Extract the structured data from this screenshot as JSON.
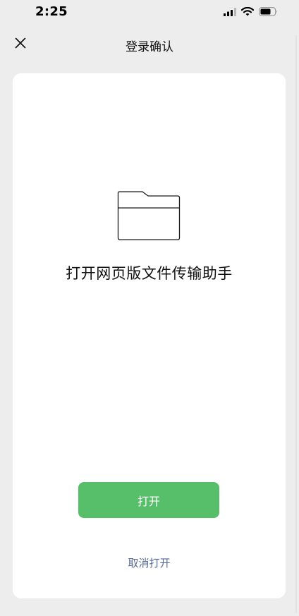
{
  "status_bar": {
    "time": "2:25",
    "icons": [
      "signal-icon",
      "wifi-icon",
      "battery-icon"
    ]
  },
  "nav": {
    "close_icon": "close-icon",
    "title": "登录确认"
  },
  "card": {
    "icon": "folder-icon",
    "title": "打开网页版文件传输助手",
    "open_button_label": "打开",
    "cancel_label": "取消打开"
  },
  "colors": {
    "background": "#ededed",
    "card": "#ffffff",
    "primary_button": "#57be6a",
    "link": "#576b95"
  }
}
